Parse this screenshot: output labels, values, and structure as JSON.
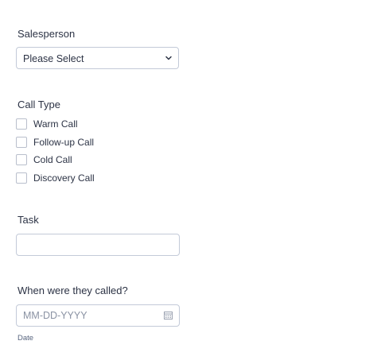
{
  "salesperson": {
    "label": "Salesperson",
    "selected": "Please Select",
    "icon": "chevron-down-icon"
  },
  "call_type": {
    "label": "Call Type",
    "options": [
      {
        "label": "Warm Call",
        "checked": false
      },
      {
        "label": "Follow-up Call",
        "checked": false
      },
      {
        "label": "Cold Call",
        "checked": false
      },
      {
        "label": "Discovery Call",
        "checked": false
      }
    ]
  },
  "task": {
    "label": "Task",
    "value": ""
  },
  "called_date": {
    "label": "When were they called?",
    "placeholder": "MM-DD-YYYY",
    "value": "",
    "sublabel": "Date",
    "icon": "calendar-icon"
  },
  "colors": {
    "text": "#2c3345",
    "border": "#c3cad8",
    "placeholder": "#8a92a3",
    "sublabel": "#57647e"
  }
}
